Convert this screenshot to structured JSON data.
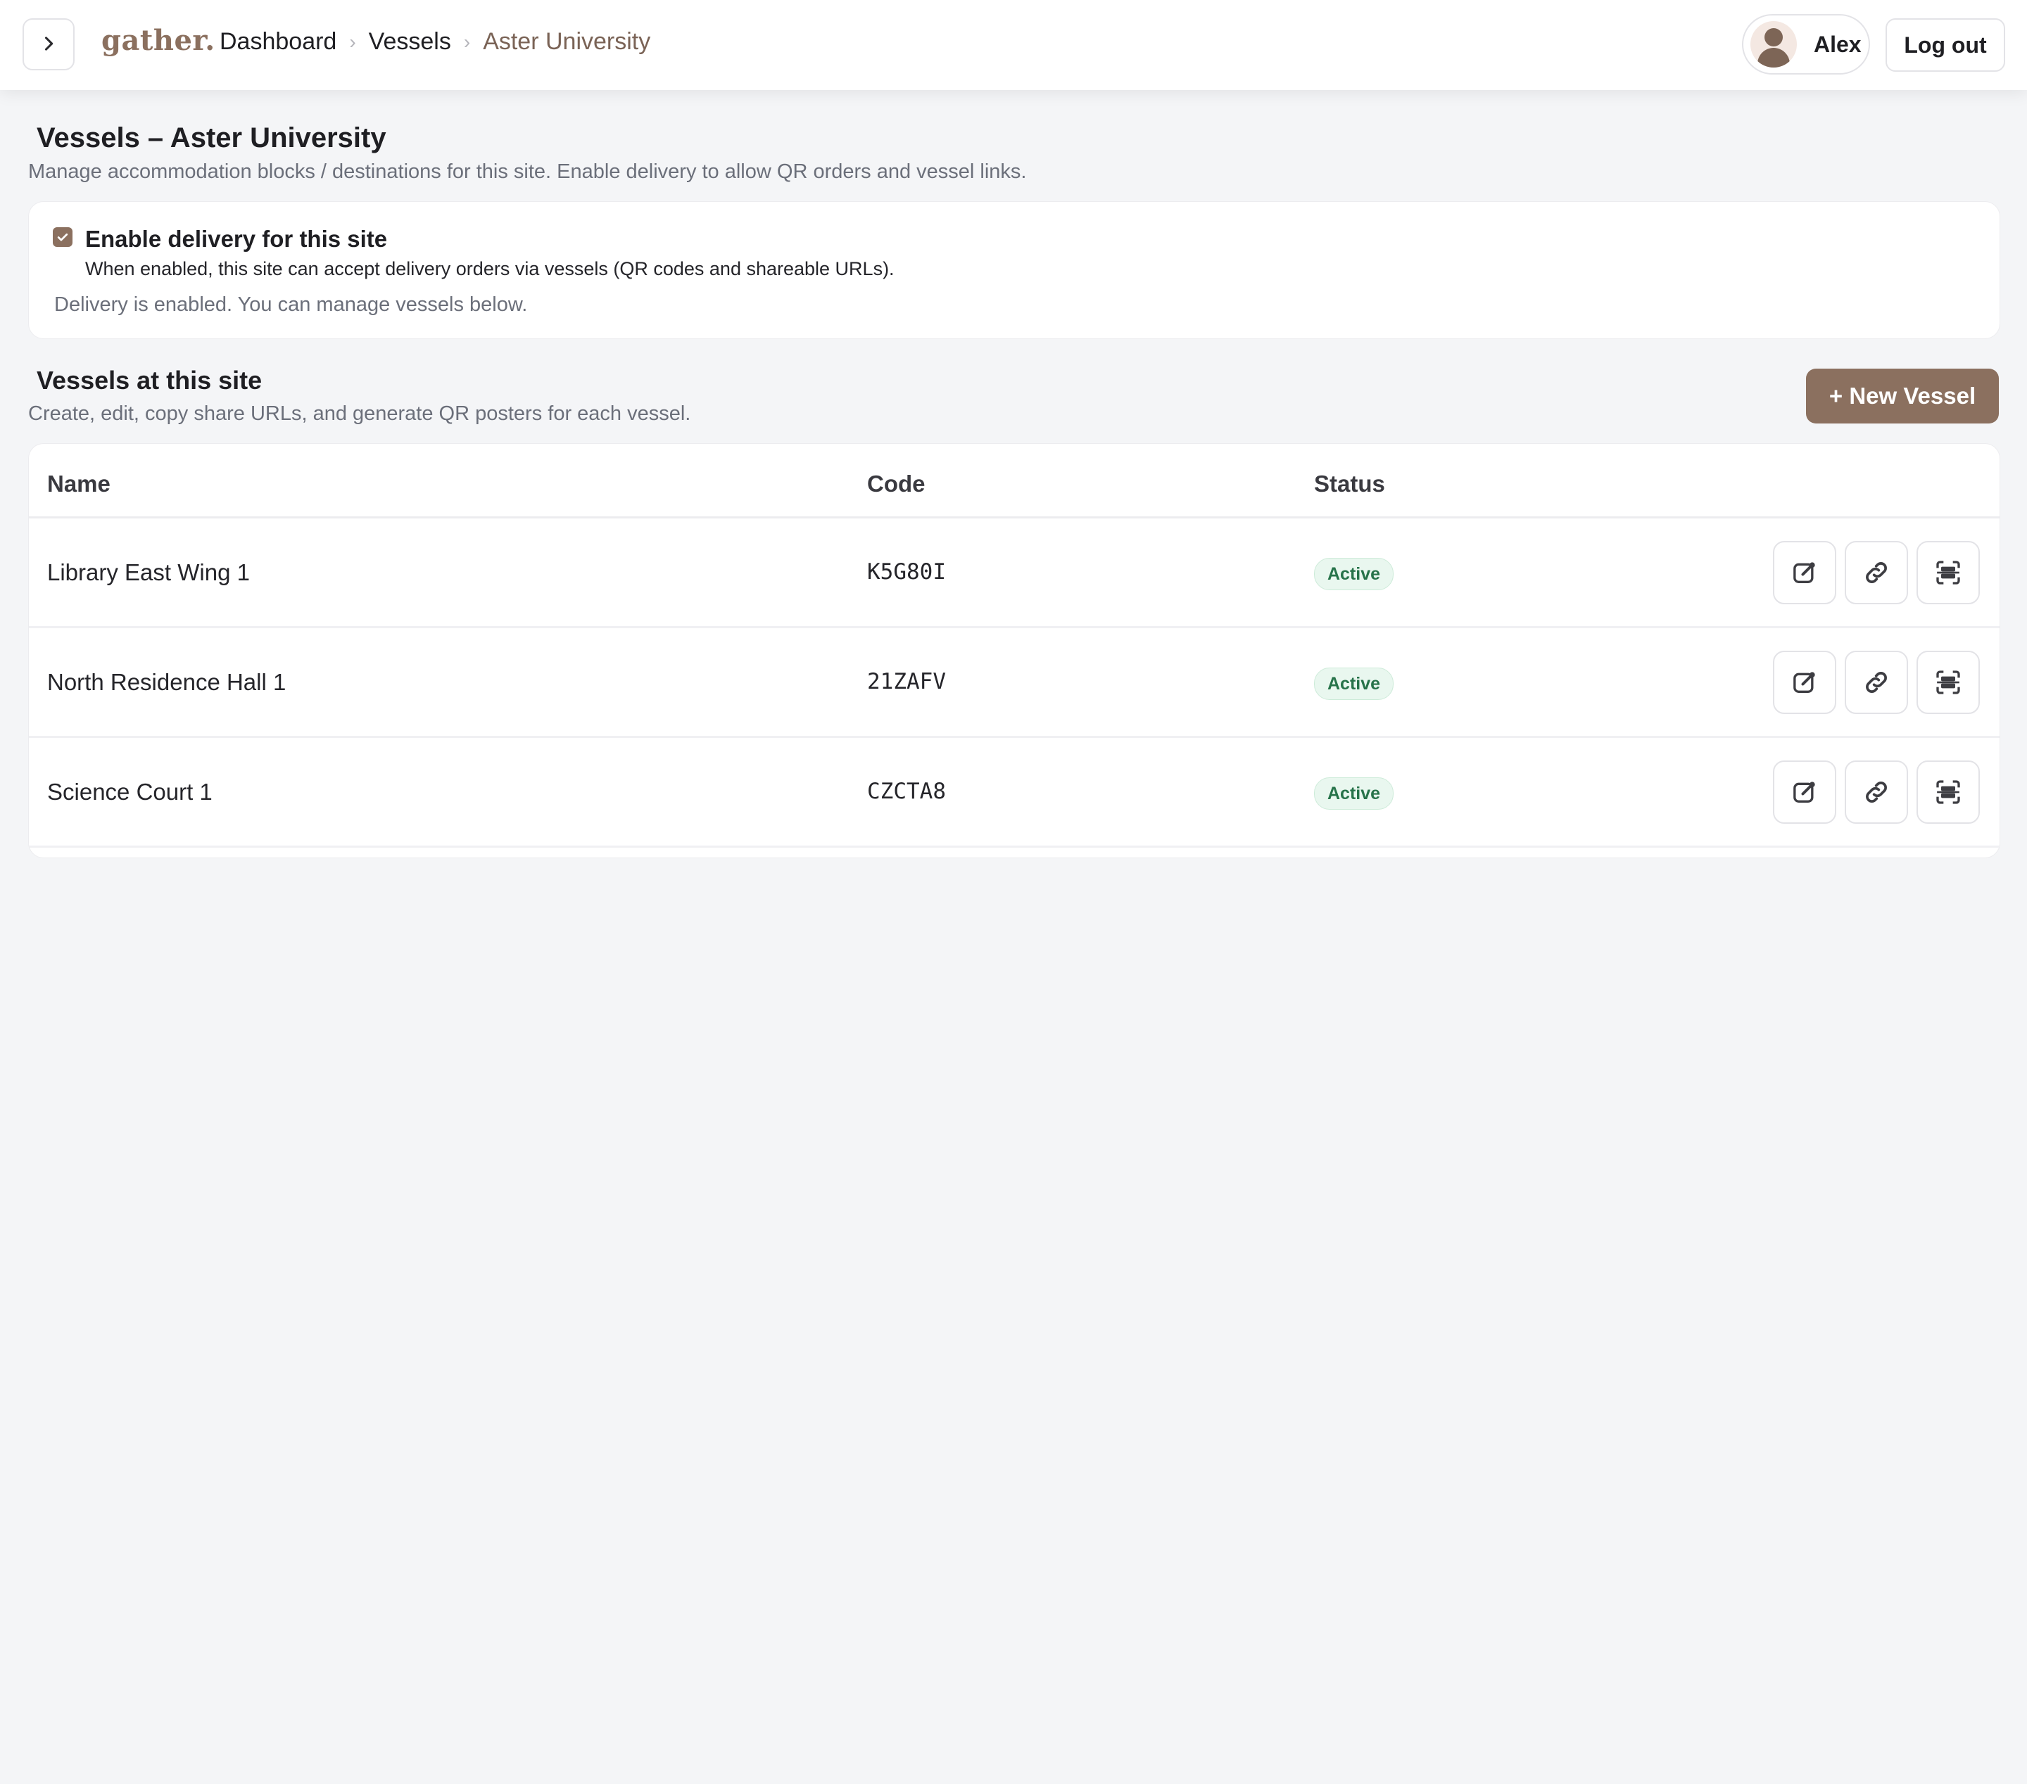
{
  "header": {
    "logo": "gather.",
    "breadcrumb": [
      "Dashboard",
      "Vessels",
      "Aster University"
    ],
    "user_name": "Alex",
    "logout_label": "Log out"
  },
  "page": {
    "title": "Vessels – Aster University",
    "subtitle": "Manage accommodation blocks / destinations for this site. Enable delivery to allow QR orders and vessel links."
  },
  "delivery": {
    "enabled": true,
    "title": "Enable delivery for this site",
    "description": "When enabled, this site can accept delivery orders via vessels (QR codes and shareable URLs).",
    "status_text": "Delivery is enabled. You can manage vessels below."
  },
  "vessels_section": {
    "title": "Vessels at this site",
    "subtitle": "Create, edit, copy share URLs, and generate QR posters for each vessel.",
    "new_button": "+ New Vessel",
    "columns": [
      "Name",
      "Code",
      "Status"
    ],
    "rows": [
      {
        "name": "Library East Wing 1",
        "code": "K5G80I",
        "status": "Active"
      },
      {
        "name": "North Residence Hall 1",
        "code": "21ZAFV",
        "status": "Active"
      },
      {
        "name": "Science Court 1",
        "code": "CZCTA8",
        "status": "Active"
      }
    ]
  },
  "colors": {
    "accent": "#8b705f",
    "active_badge_bg": "#e9f7ef",
    "active_badge_text": "#27734a"
  },
  "icons": {
    "sidebar_toggle": "chevron-right-icon",
    "row_actions": [
      "edit-icon",
      "link-icon",
      "qr-scan-icon"
    ]
  }
}
